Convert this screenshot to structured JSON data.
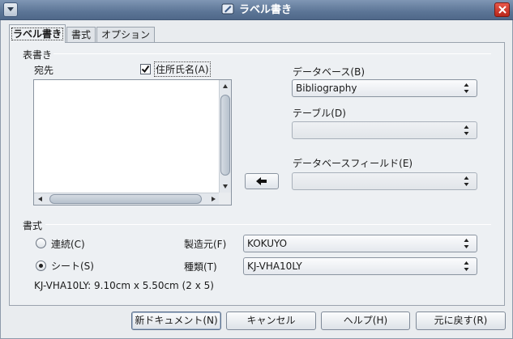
{
  "window": {
    "title": "ラベル書き"
  },
  "tabs": [
    {
      "label": "ラベル書き",
      "active": true
    },
    {
      "label": "書式",
      "active": false
    },
    {
      "label": "オプション",
      "active": false
    }
  ],
  "inscription": {
    "section_label": "表書き",
    "addressee_label": "宛先",
    "address_checkbox_label": "住所氏名(A)",
    "address_checkbox_checked": true,
    "database_label": "データベース(B)",
    "database_value": "Bibliography",
    "table_label": "テーブル(D)",
    "table_value": "",
    "db_field_label": "データベースフィールド(E)",
    "db_field_value": ""
  },
  "format": {
    "section_label": "書式",
    "continuous_label": "連続(C)",
    "continuous_selected": false,
    "sheet_label": "シート(S)",
    "sheet_selected": true,
    "brand_label": "製造元(F)",
    "brand_value": "KOKUYO",
    "type_label": "種類(T)",
    "type_value": "KJ-VHA10LY",
    "info_text": "KJ-VHA10LY: 9.10cm x 5.50cm (2 x 5)"
  },
  "buttons": {
    "new_document": "新ドキュメント(N)",
    "cancel": "キャンセル",
    "help": "ヘルプ(H)",
    "reset": "元に戻す(R)"
  },
  "colors": {
    "titlebar": "#5c7596",
    "close_button": "#c8372a",
    "panel": "#edf0f3"
  }
}
